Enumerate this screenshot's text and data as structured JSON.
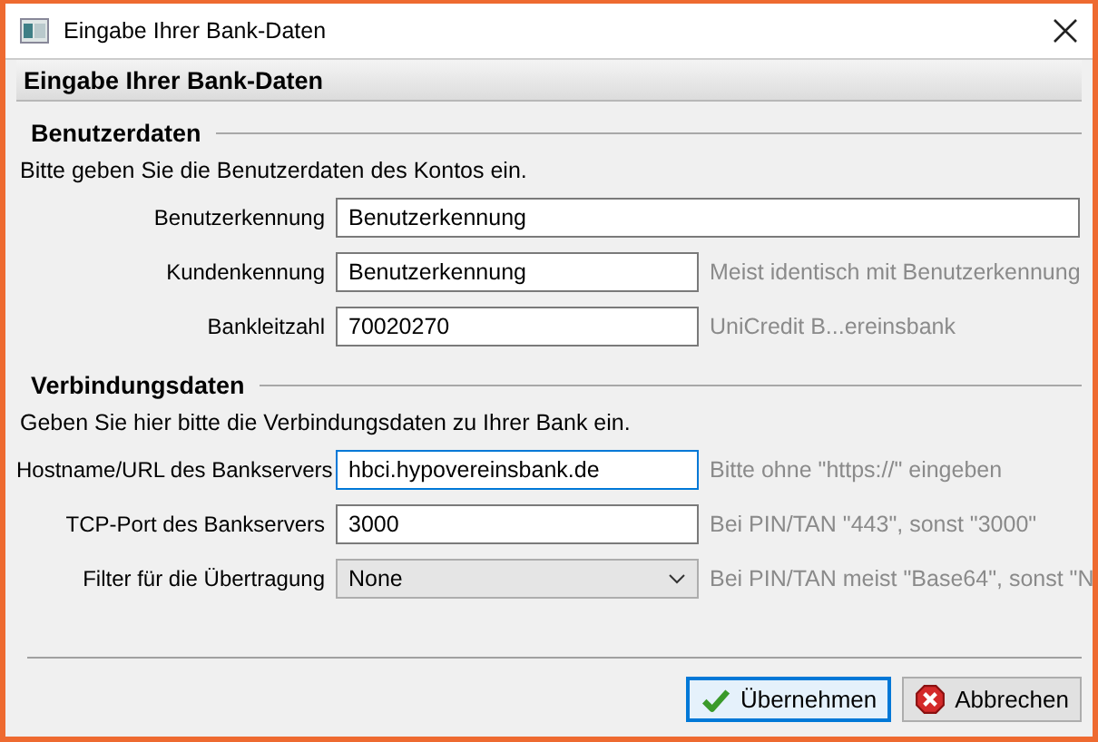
{
  "window": {
    "title": "Eingabe Ihrer Bank-Daten"
  },
  "header": "Eingabe Ihrer Bank-Daten",
  "sections": [
    {
      "title": "Benutzerdaten",
      "description": "Bitte geben Sie die Benutzerdaten des Kontos ein.",
      "fields": [
        {
          "kind": "text",
          "label": "Benutzerkennung",
          "value": "Benutzerkennung",
          "focused": false,
          "wide": true
        },
        {
          "kind": "text",
          "label": "Kundenkennung",
          "value": "Benutzerkennung",
          "focused": false,
          "hint": "Meist identisch mit Benutzerkennung"
        },
        {
          "kind": "text",
          "label": "Bankleitzahl",
          "value": "70020270",
          "focused": false,
          "hint": "UniCredit B...ereinsbank"
        }
      ]
    },
    {
      "title": "Verbindungsdaten",
      "description": "Geben Sie hier bitte die Verbindungsdaten zu Ihrer Bank ein.",
      "fields": [
        {
          "kind": "text",
          "label": "Hostname/URL des Bankservers",
          "value": "hbci.hypovereinsbank.de",
          "focused": true,
          "hint": "Bitte ohne \"https://\" eingeben"
        },
        {
          "kind": "text",
          "label": "TCP-Port des Bankservers",
          "value": "3000",
          "focused": false,
          "hint": "Bei PIN/TAN \"443\", sonst \"3000\""
        },
        {
          "kind": "select",
          "label": "Filter für die Übertragung",
          "value": "None",
          "focused": false,
          "hint": "Bei PIN/TAN meist \"Base64\", sonst \"N"
        }
      ]
    }
  ],
  "buttons": [
    {
      "kind": "ok",
      "label": "Übernehmen",
      "default": true
    },
    {
      "kind": "cancel",
      "label": "Abbrechen",
      "default": false
    }
  ]
}
